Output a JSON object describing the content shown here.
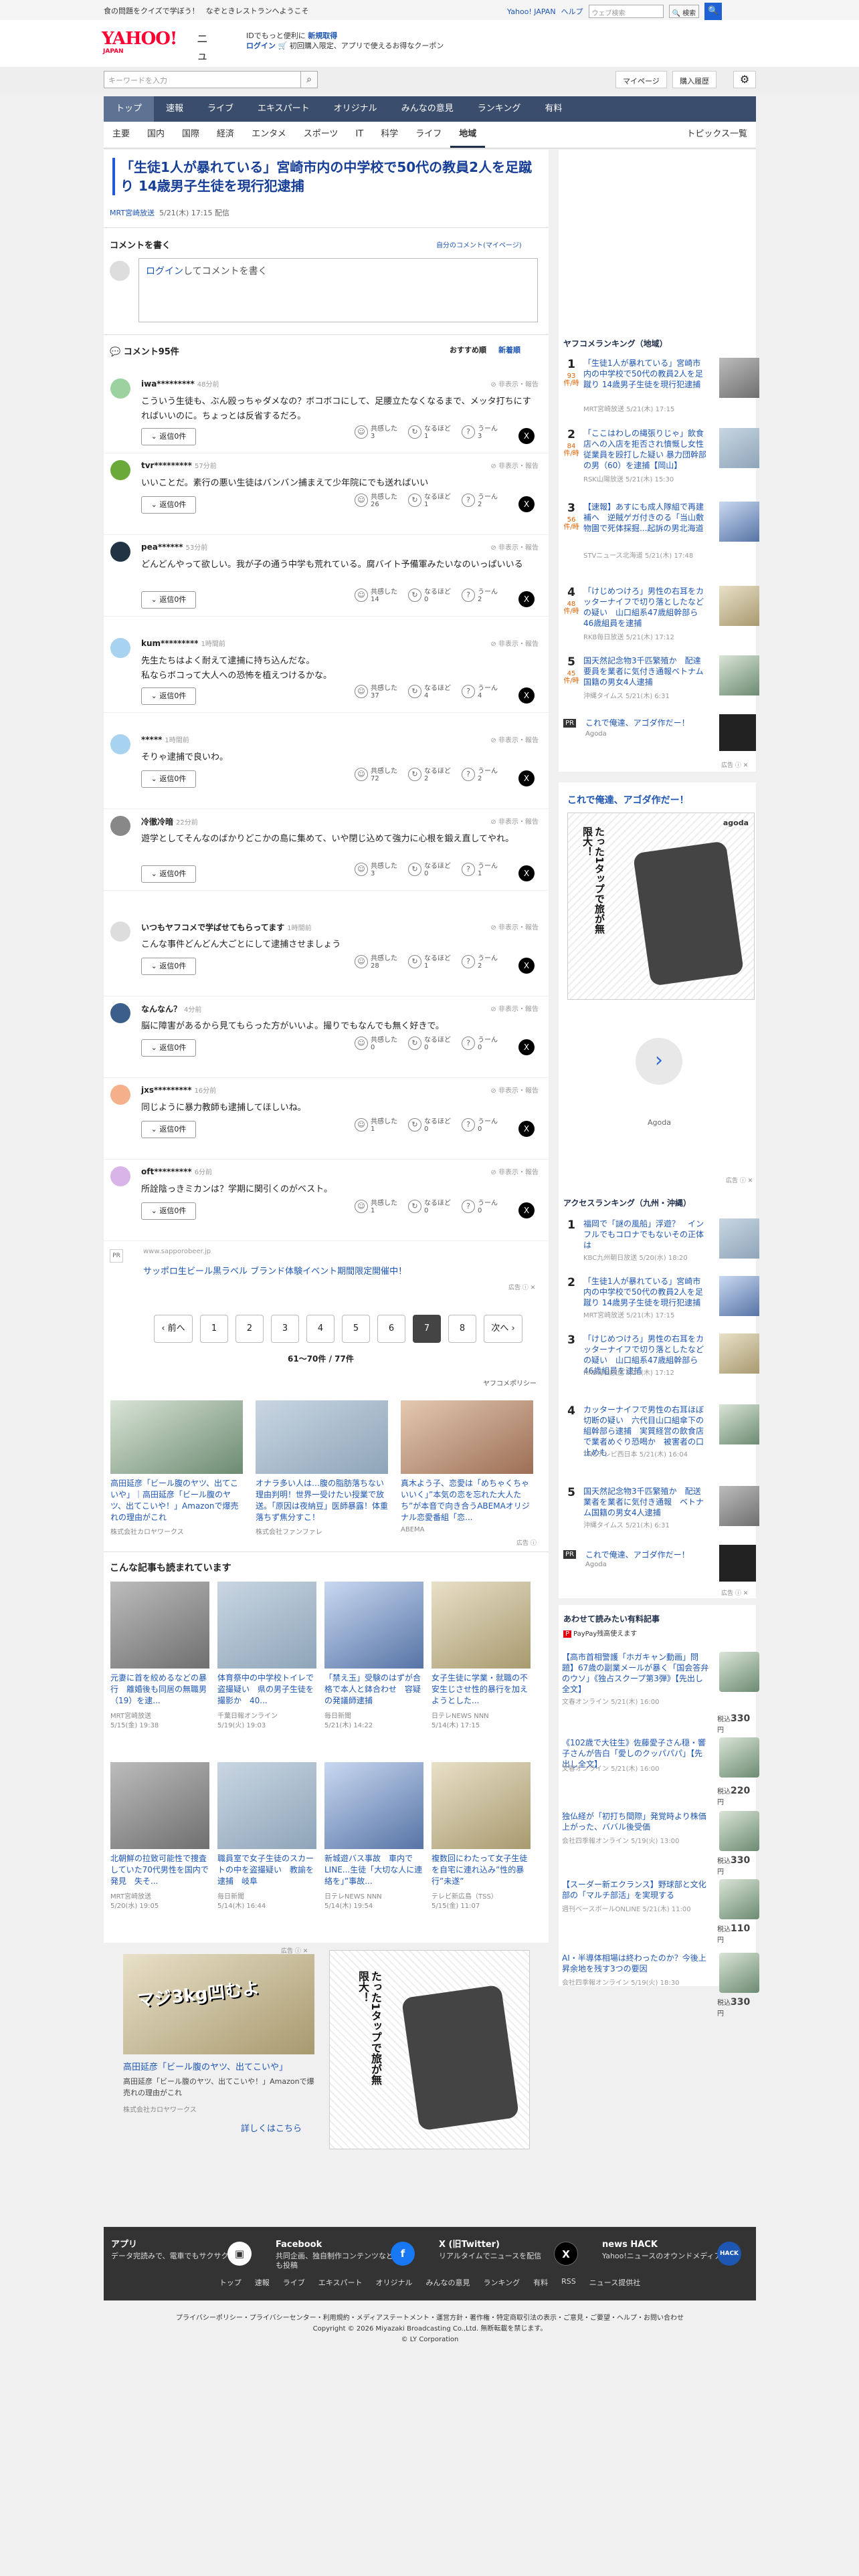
{
  "topbar": {
    "left1": "食の問題をクイズで学ぼう！",
    "left2": "なぞときレストランへようこそ",
    "links": [
      "Yahoo! JAPAN",
      "ヘルプ"
    ],
    "search_placeholder": "ウェブ検索",
    "search_btn": "検索"
  },
  "header": {
    "logo": "YAHOO!",
    "logo_sub": "JAPAN",
    "service": "ニュース",
    "promo1": "IDでもっと便利に",
    "promo1b": "新規取得",
    "promo2": "ログイン",
    "promo3": "初回購入限定、アプリで使えるお得なクーポン"
  },
  "toolbar": {
    "search_placeholder": "キーワードを入力",
    "mypage": "マイページ",
    "purchase": "購入履歴"
  },
  "nav1": [
    "トップ",
    "速報",
    "ライブ",
    "エキスパート",
    "オリジナル",
    "みんなの意見",
    "ランキング",
    "有料"
  ],
  "nav2": [
    "主要",
    "国内",
    "国際",
    "経済",
    "エンタメ",
    "スポーツ",
    "IT",
    "科学",
    "ライフ",
    "地域"
  ],
  "nav2_topics": "トピックス一覧",
  "article": {
    "title": "「生徒1人が暴れている」宮崎市内の中学校で50代の教員2人を足蹴り 14歳男子生徒を現行犯逮捕",
    "source": "MRT宮崎放送",
    "date": "5/21(木) 17:15 配信"
  },
  "compose": {
    "title": "コメントを書く",
    "my_comments": "自分のコメント(マイページ)",
    "login": "ログイン",
    "placeholder": "してコメントを書く"
  },
  "comments_head": {
    "title": "コメント95件",
    "sort1": "おすすめ順",
    "sort2": "新着順"
  },
  "comments": [
    {
      "name": "iwa*********",
      "time": "48分前",
      "text": "こういう生徒も、ぶん殴っちゃダメなの？ボコボコにして、足腰立たなくなるまで、メッタ打ちにすればいいのに。ちょっとは反省するだろ。",
      "reply": "返信0件",
      "like": "3",
      "agree": "1",
      "hmm": "3",
      "hide": "非表示・報告"
    },
    {
      "name": "tvr*********",
      "time": "57分前",
      "text": "いいことだ。素行の悪い生徒はバンバン捕まえて少年院にでも送ればいい",
      "reply": "返信0件",
      "like": "26",
      "agree": "1",
      "hmm": "2",
      "hide": "非表示・報告"
    },
    {
      "name": "pea******",
      "time": "53分前",
      "text": "どんどんやって欲しい。我が子の通う中学も荒れている。腐バイト予備軍みたいなのいっぱいいる",
      "reply": "返信0件",
      "like": "14",
      "agree": "0",
      "hmm": "2",
      "hide": "非表示・報告"
    },
    {
      "name": "kum*********",
      "time": "1時間前",
      "text": "先生たちはよく耐えて逮捕に持ち込んだな。\n私ならボコって大人への恐怖を植えつけるかな。",
      "reply": "返信0件",
      "like": "37",
      "agree": "4",
      "hmm": "4",
      "hide": "非表示・報告"
    },
    {
      "name": "*****",
      "time": "1時間前",
      "text": "そりゃ逮捕で良いわ。",
      "reply": "返信0件",
      "like": "72",
      "agree": "2",
      "hmm": "2",
      "hide": "非表示・報告"
    },
    {
      "name": "冷徹冷暗",
      "time": "22分前",
      "text": "遊学としてそんなのばかりどこかの島に集めて、いや閉じ込めて強力に心根を鍛え直してやれ。",
      "reply": "返信0件",
      "like": "3",
      "agree": "0",
      "hmm": "1",
      "hide": "非表示・報告"
    },
    {
      "name": "いつもヤフコメで学ばせてもらってます",
      "time": "1時間前",
      "text": "こんな事件どんどん大ごとにして逮捕させましょう",
      "reply": "返信0件",
      "like": "28",
      "agree": "1",
      "hmm": "2",
      "hide": "非表示・報告"
    },
    {
      "name": "なんなん？",
      "time": "4分前",
      "text": "脳に障害があるから見てもらった方がいいよ。撮りでもなんでも無く好きで。",
      "reply": "返信0件",
      "like": "0",
      "agree": "0",
      "hmm": "0",
      "hide": "非表示・報告"
    },
    {
      "name": "jxs*********",
      "time": "16分前",
      "text": "同じように暴力教師も逮捕してほしいね。",
      "reply": "返信0件",
      "like": "1",
      "agree": "0",
      "hmm": "0",
      "hide": "非表示・報告"
    },
    {
      "name": "oft*********",
      "time": "6分前",
      "text": "所詮陰っきミカンは？学期に関引くのがベスト。",
      "reply": "返信0件",
      "like": "1",
      "agree": "0",
      "hmm": "0",
      "hide": "非表示・報告"
    }
  ],
  "reactions": {
    "like": "共感した",
    "agree": "なるほど",
    "hmm": "うーん"
  },
  "inline_ad": {
    "url": "www.sapporobeer.jp",
    "text": "サッポロ生ビール黒ラベル ブランド体験イベント期間限定開催中！",
    "label": "広告"
  },
  "pager": {
    "prev": "前へ",
    "pages": [
      "1",
      "2",
      "3",
      "4",
      "5",
      "6",
      "7",
      "8"
    ],
    "next": "次へ",
    "info": "61〜70件 / 77件",
    "policy": "ヤフコメポリシー"
  },
  "ad_grid": [
    {
      "title": "高田延彦「ビール腹のヤツ、出てこいや」｜高田延彦「ビール腹のヤツ、出てこいや！」Amazonで爆売れの理由がこれ",
      "sub": "株式会社カロヤワークス"
    },
    {
      "title": "オナラ多い人は…腹の脂肪落ちない理由判明！世界一受けたい授業で放送。「原因は夜納豆」医師暴露！体重落ちず焦分すこ！",
      "sub": "株式会社ファンファレ"
    },
    {
      "title": "真木よう子、恋愛は「めちゃくちゃいいく」”本気の恋を忘れた大人たち”が本音で向き合うABEMAオリジナル恋愛番組「恋...",
      "sub": "ABEMA"
    }
  ],
  "also_read": {
    "title": "こんな記事も読まれています",
    "items": [
      {
        "t": "元妻に首を絞めるなどの暴行　離婚後も同居の無職男（19）を逮...",
        "s": "MRT宮崎放送",
        "d": "5/15(金) 19:38"
      },
      {
        "t": "体育祭中の中学校トイレで盗撮疑い　県の男子生徒を撮影か　40...",
        "s": "千葉日報オンライン",
        "d": "5/19(火) 19:03"
      },
      {
        "t": "「禁え玉」受験のはずが合格で本人と鉢合わせ　容疑の発議師逮捕",
        "s": "毎日新聞",
        "d": "5/21(木) 14:22"
      },
      {
        "t": "女子生徒に学業・就職の不安生じさせ性的暴行を加えようとした...",
        "s": "日テレNEWS NNN",
        "d": "5/14(木) 17:15"
      },
      {
        "t": "北朝鮮の拉致可能性で捜査していた70代男性を国内で発見　失そ...",
        "s": "MRT宮崎放送",
        "d": "5/20(水) 19:05"
      },
      {
        "t": "職員室で女子生徒のスカートの中を盗撮疑い　教諭を逮捕　岐阜",
        "s": "毎日新聞",
        "d": "5/14(木) 16:44"
      },
      {
        "t": "新城遊バス事故　車内でLINE...生徒「大切な人に連絡を」”事故...",
        "s": "日テレNEWS NNN",
        "d": "5/14(木) 19:54"
      },
      {
        "t": "複数回にわたって女子生徒を自宅に連れ込み”性的暴行”未遂”",
        "s": "テレビ新広島（TSS）",
        "d": "5/15(金) 11:07"
      }
    ]
  },
  "bottom_ad": {
    "title": "高田延彦「ビール腹のヤツ、出てこいや」",
    "desc": "高田延彦「ビール腹のヤツ、出てこいや！」Amazonで爆売れの理由がこれ",
    "sub": "株式会社カロヤワークス",
    "more": "詳しくはこちら",
    "banner": "マジ3kg凹むよ"
  },
  "rank1": {
    "title": "ヤフコメランキング（地域）",
    "items": [
      {
        "no": "1",
        "cnt": "93",
        "unit": "件/時",
        "t": "「生徒1人が暴れている」宮崎市内の中学校で50代の教員2人を足蹴り 14歳男子生徒を現行犯逮捕",
        "m": "MRT宮崎放送 5/21(木) 17:15"
      },
      {
        "no": "2",
        "cnt": "84",
        "unit": "件/時",
        "t": "「ここはわしの縄張りじゃ」飲食店への入店を拒否され憤慨し女性従業員を殴打した疑い 暴力団幹部の男（60）を逮捕【岡山】",
        "m": "RSK山陽放送 5/21(木) 15:30"
      },
      {
        "no": "3",
        "cnt": "56",
        "unit": "件/時",
        "t": "【速報】あすにも成人隊組で再建補へ　逆賊ゲガ付きのる「当山敷物園で死体採掘...起訴の男北海道",
        "m": "STVニュース北海道 5/21(木) 17:48"
      },
      {
        "no": "4",
        "cnt": "48",
        "unit": "件/時",
        "t": "「けじめつけろ」男性の右耳をカッターナイフで切り落としたなどの疑い　山口組系47歳組幹部ら46歳組員を逮捕",
        "m": "RKB毎日放送 5/21(木) 17:12"
      },
      {
        "no": "5",
        "cnt": "45",
        "unit": "件/時",
        "t": "国天然記念物3千匹繁殖か　配達要員を業者に気付き通報ベトナム国籍の男女4人逮捕",
        "m": "沖縄タイムス 5/21(木) 6:31"
      }
    ],
    "pr": "これで俺達、アゴダ作だー！",
    "pr_sub": "Agoda"
  },
  "side_ad": {
    "title": "これで俺達、アゴダ作だー！",
    "brand": "agoda",
    "manga": "たった1タップで旅が無限大！",
    "footer": "Agoda",
    "label": "広告"
  },
  "rank2": {
    "title": "アクセスランキング（九州・沖縄）",
    "items": [
      {
        "no": "1",
        "t": "福岡で「謎の風船」浮遊？　インフルでもコロナでもないその正体は",
        "m": "KBC九州朝日放送 5/20(水) 18:20"
      },
      {
        "no": "2",
        "t": "「生徒1人が暴れている」宮崎市内の中学校で50代の教員2人を足蹴り 14歳男子生徒を現行犯逮捕",
        "m": "MRT宮崎放送 5/21(木) 17:15"
      },
      {
        "no": "3",
        "t": "「けじめつけろ」男性の右耳をカッターナイフで切り落としたなどの疑い　山口組系47歳組幹部ら46歳組員を逮捕",
        "m": "RKB毎日放送 5/21(木) 17:12"
      },
      {
        "no": "4",
        "t": "カッターナイフで男性の右耳ほぼ切断の疑い　六代目山口組傘下の組幹部ら逮捕　実質経営の飲食店で業者めぐり恐喝か　被害者の口止めも",
        "m": "TNCテレビ西日本 5/21(木) 16:04"
      },
      {
        "no": "5",
        "t": "国天然記念物3千匹繁殖か　配送業者を業者に気付き通報　ベトナム国籍の男女4人逮捕",
        "m": "沖縄タイムス 5/21(木) 6:31"
      }
    ],
    "pr": "これで俺達、アゴダ作だー！",
    "pr_sub": "Agoda"
  },
  "paid": {
    "title": "あわせて読みたい有料記事",
    "brand": "PayPay残高使えます",
    "items": [
      {
        "t": "【高市首相警護「ホガキャン動画」問題】67歳の副業メールが暴く「国会答弁のウソ」《独占スクープ第3弾》【先出し全文】",
        "s": "文春オンライン 5/21(木) 16:00",
        "p": "330"
      },
      {
        "t": "《102歳で大往生》佐藤愛子さん穏・響子さんが告白「愛しのクッパパパ」【先出し全文】",
        "s": "文春オンライン 5/21(木) 16:00",
        "p": "220"
      },
      {
        "t": "独仏経が「初打ち間際」発覚時より株価上がった、ババル後受価",
        "s": "会社四季報オンライン 5/19(火) 13:00",
        "p": "330"
      },
      {
        "t": "【スーダー新エクランス】野球部と文化部の「マルチ部活」を実現する",
        "s": "週刊ベースボールONLINE 5/21(木) 11:00",
        "p": "110"
      },
      {
        "t": "AI・半導体相場は終わったのか？今後上昇余地を残す3つの要因",
        "s": "会社四季報オンライン 5/19(火) 18:30",
        "p": "330"
      }
    ],
    "tax": "税込"
  },
  "footer": {
    "items": [
      {
        "t": "アプリ",
        "d": "データ完読みで、電車でもサクサク"
      },
      {
        "t": "Facebook",
        "d": "共同企画、独自制作コンテンツなども投稿"
      },
      {
        "t": "X (旧Twitter)",
        "d": "リアルタイムでニュースを配信"
      },
      {
        "t": "news HACK",
        "d": "Yahoo!ニュースのオウンドメディア"
      }
    ],
    "links": [
      "トップ",
      "速報",
      "ライブ",
      "エキスパート",
      "オリジナル",
      "みんなの意見",
      "ランキング",
      "有料",
      "RSS",
      "ニュース提供社"
    ],
    "legal1": "プライバシーポリシー・プライバシーセンター・利用規約・メディアステートメント・運営方針・著作権・特定商取引法の表示・ご意見・ご要望・ヘルプ・お問い合わせ",
    "legal2": "Copyright © 2026 Miyazaki Broadcasting Co.,Ltd. 無断転載を禁じます。",
    "legal3": "© LY Corporation"
  }
}
